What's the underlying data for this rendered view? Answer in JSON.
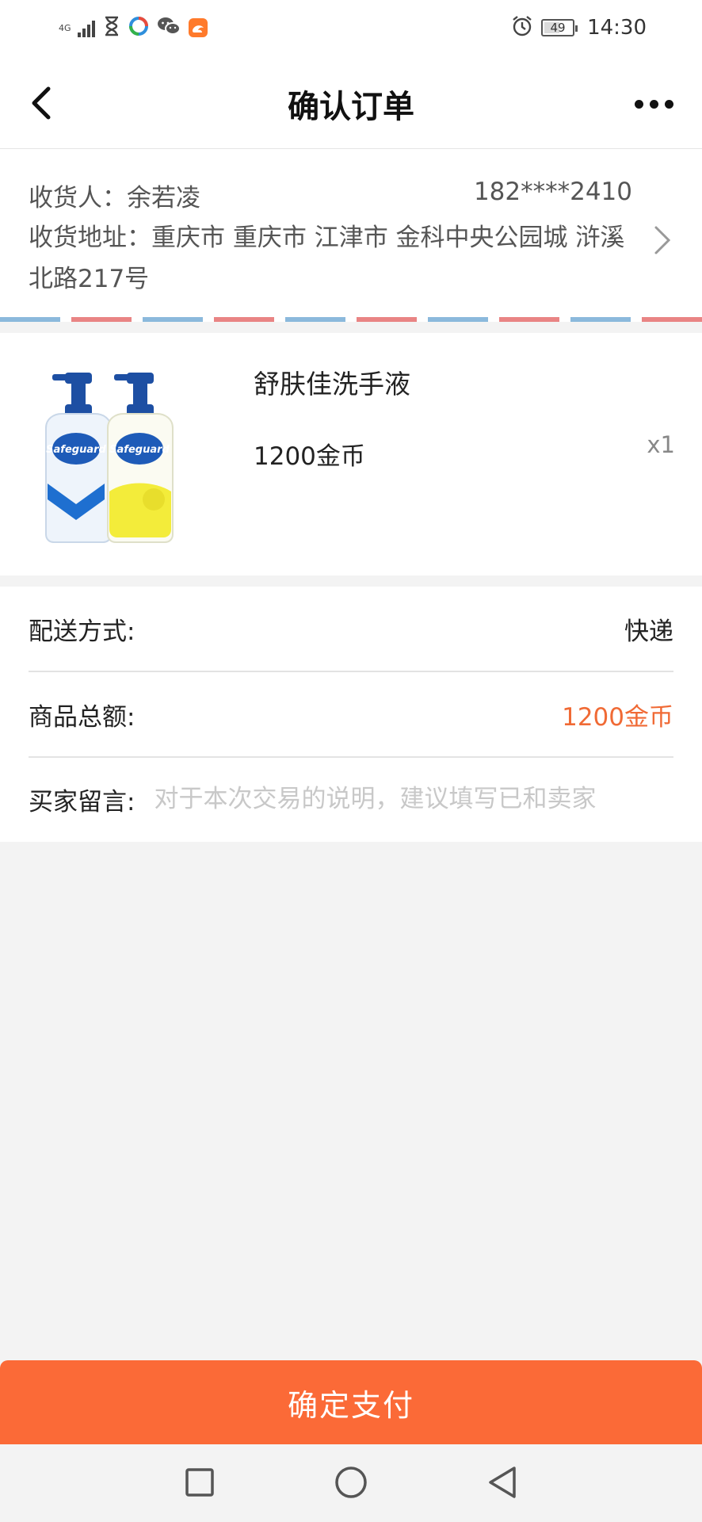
{
  "status_bar": {
    "network": "4G",
    "battery": "49",
    "time": "14:30",
    "icons": [
      "signal-icon",
      "hourglass-icon",
      "news-app-icon",
      "wechat-icon",
      "uc-browser-icon",
      "alarm-icon",
      "battery-icon"
    ]
  },
  "header": {
    "title": "确认订单",
    "back_icon": "chevron-left-icon",
    "more_icon": "more-icon"
  },
  "address": {
    "recipient_label": "收货人：",
    "recipient_name": "余若凌",
    "phone": "182****2410",
    "address_label": "收货地址：",
    "address_line": "重庆市 重庆市 江津市 金科中央公园城 浒溪北路217号"
  },
  "product": {
    "name": "舒肤佳洗手液",
    "price": "1200金币",
    "quantity": "x1"
  },
  "order_info": {
    "shipping_label": "配送方式:",
    "shipping_value": "快递",
    "total_label": "商品总额:",
    "total_value": "1200金币",
    "message_label": "买家留言:",
    "message_placeholder": "对于本次交易的说明，建议填写已和卖家",
    "message_value": ""
  },
  "actions": {
    "pay_label": "确定支付"
  },
  "colors": {
    "accent": "#fb6a37",
    "price_accent": "#f06a35",
    "background": "#f3f3f3"
  },
  "system_nav": [
    "recent-apps-icon",
    "home-icon",
    "back-icon"
  ]
}
